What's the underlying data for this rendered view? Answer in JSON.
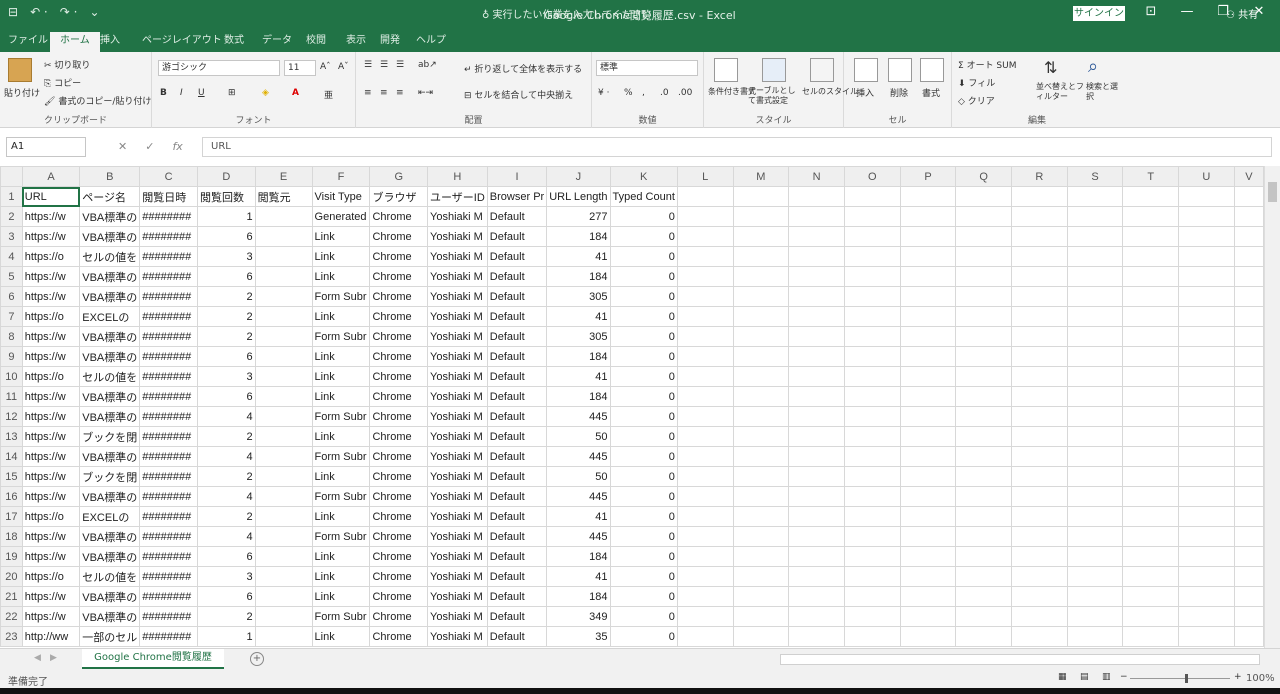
{
  "titlebar": {
    "doc_title": "Google Chrome閲覧履歴.csv  -  Excel",
    "signin": "サインイン",
    "qat": [
      "⊟",
      "↶ ·",
      "↷ ·",
      "⌄"
    ]
  },
  "tabs": [
    {
      "label": "ファイル",
      "active": false
    },
    {
      "label": "ホーム",
      "active": true
    },
    {
      "label": "挿入",
      "active": false
    },
    {
      "label": "ページレイアウト",
      "active": false
    },
    {
      "label": "数式",
      "active": false
    },
    {
      "label": "データ",
      "active": false
    },
    {
      "label": "校閲",
      "active": false
    },
    {
      "label": "表示",
      "active": false
    },
    {
      "label": "開発",
      "active": false
    },
    {
      "label": "ヘルプ",
      "active": false
    }
  ],
  "tell_me": "実行したい作業を入力してください",
  "share": "共有",
  "ribbon": {
    "clipboard": {
      "paste": "貼り付け",
      "cut": "切り取り",
      "copy": "コピー",
      "format_painter": "書式のコピー/貼り付け",
      "label": "クリップボード"
    },
    "font": {
      "name": "游ゴシック",
      "size": "11",
      "label": "フォント"
    },
    "alignment": {
      "wrap": "折り返して全体を表示する",
      "merge": "セルを結合して中央揃え",
      "label": "配置"
    },
    "number": {
      "format": "標準",
      "label": "数値"
    },
    "styles": {
      "cond": "条件付き書式",
      "table": "テーブルとして書式設定",
      "cell": "セルのスタイル",
      "label": "スタイル"
    },
    "cells": {
      "insert": "挿入",
      "delete": "削除",
      "format": "書式",
      "label": "セル"
    },
    "editing": {
      "autosum": "オート SUM",
      "fill": "フィル",
      "clear": "クリア",
      "sort": "並べ替えとフィルター",
      "find": "検索と選択",
      "label": "編集"
    }
  },
  "formula_bar": {
    "name_box": "A1",
    "cancel": "✕",
    "enter": "✓",
    "fx": "fx",
    "formula": "URL"
  },
  "columns": [
    "A",
    "B",
    "C",
    "D",
    "E",
    "F",
    "G",
    "H",
    "I",
    "J",
    "K",
    "L",
    "M",
    "N",
    "O",
    "P",
    "Q",
    "R",
    "S",
    "T",
    "U",
    "V"
  ],
  "header_row": [
    "URL",
    "ページ名",
    "閲覧日時",
    "閲覧回数",
    "閲覧元",
    "Visit Type",
    "ブラウザ",
    "ユーザーID",
    "Browser Pr",
    "URL Length",
    "Typed Count"
  ],
  "rows": [
    [
      "https://w",
      "VBA標準の",
      "########",
      "1",
      "",
      "Generated",
      "Chrome",
      "Yoshiaki M",
      "Default",
      "277",
      "0"
    ],
    [
      "https://w",
      "VBA標準の",
      "########",
      "6",
      "",
      "Link",
      "Chrome",
      "Yoshiaki M",
      "Default",
      "184",
      "0"
    ],
    [
      "https://o",
      "セルの値を",
      "########",
      "3",
      "",
      "Link",
      "Chrome",
      "Yoshiaki M",
      "Default",
      "41",
      "0"
    ],
    [
      "https://w",
      "VBA標準の",
      "########",
      "6",
      "",
      "Link",
      "Chrome",
      "Yoshiaki M",
      "Default",
      "184",
      "0"
    ],
    [
      "https://w",
      "VBA標準の",
      "########",
      "2",
      "",
      "Form Subr",
      "Chrome",
      "Yoshiaki M",
      "Default",
      "305",
      "0"
    ],
    [
      "https://o",
      "EXCELの",
      "########",
      "2",
      "",
      "Link",
      "Chrome",
      "Yoshiaki M",
      "Default",
      "41",
      "0"
    ],
    [
      "https://w",
      "VBA標準の",
      "########",
      "2",
      "",
      "Form Subr",
      "Chrome",
      "Yoshiaki M",
      "Default",
      "305",
      "0"
    ],
    [
      "https://w",
      "VBA標準の",
      "########",
      "6",
      "",
      "Link",
      "Chrome",
      "Yoshiaki M",
      "Default",
      "184",
      "0"
    ],
    [
      "https://o",
      "セルの値を",
      "########",
      "3",
      "",
      "Link",
      "Chrome",
      "Yoshiaki M",
      "Default",
      "41",
      "0"
    ],
    [
      "https://w",
      "VBA標準の",
      "########",
      "6",
      "",
      "Link",
      "Chrome",
      "Yoshiaki M",
      "Default",
      "184",
      "0"
    ],
    [
      "https://w",
      "VBA標準の",
      "########",
      "4",
      "",
      "Form Subr",
      "Chrome",
      "Yoshiaki M",
      "Default",
      "445",
      "0"
    ],
    [
      "https://w",
      "ブックを閉",
      "########",
      "2",
      "",
      "Link",
      "Chrome",
      "Yoshiaki M",
      "Default",
      "50",
      "0"
    ],
    [
      "https://w",
      "VBA標準の",
      "########",
      "4",
      "",
      "Form Subr",
      "Chrome",
      "Yoshiaki M",
      "Default",
      "445",
      "0"
    ],
    [
      "https://w",
      "ブックを閉",
      "########",
      "2",
      "",
      "Link",
      "Chrome",
      "Yoshiaki M",
      "Default",
      "50",
      "0"
    ],
    [
      "https://w",
      "VBA標準の",
      "########",
      "4",
      "",
      "Form Subr",
      "Chrome",
      "Yoshiaki M",
      "Default",
      "445",
      "0"
    ],
    [
      "https://o",
      "EXCELの",
      "########",
      "2",
      "",
      "Link",
      "Chrome",
      "Yoshiaki M",
      "Default",
      "41",
      "0"
    ],
    [
      "https://w",
      "VBA標準の",
      "########",
      "4",
      "",
      "Form Subr",
      "Chrome",
      "Yoshiaki M",
      "Default",
      "445",
      "0"
    ],
    [
      "https://w",
      "VBA標準の",
      "########",
      "6",
      "",
      "Link",
      "Chrome",
      "Yoshiaki M",
      "Default",
      "184",
      "0"
    ],
    [
      "https://o",
      "セルの値を",
      "########",
      "3",
      "",
      "Link",
      "Chrome",
      "Yoshiaki M",
      "Default",
      "41",
      "0"
    ],
    [
      "https://w",
      "VBA標準の",
      "########",
      "6",
      "",
      "Link",
      "Chrome",
      "Yoshiaki M",
      "Default",
      "184",
      "0"
    ],
    [
      "https://w",
      "VBA標準の",
      "########",
      "2",
      "",
      "Form Subr",
      "Chrome",
      "Yoshiaki M",
      "Default",
      "349",
      "0"
    ],
    [
      "http://ww",
      "一部のセル",
      "########",
      "1",
      "",
      "Link",
      "Chrome",
      "Yoshiaki M",
      "Default",
      "35",
      "0"
    ]
  ],
  "sheet_tab": "Google Chrome閲覧履歴",
  "status": {
    "ready": "準備完了",
    "zoom": "100%"
  },
  "colors": {
    "excel_green": "#217346"
  }
}
